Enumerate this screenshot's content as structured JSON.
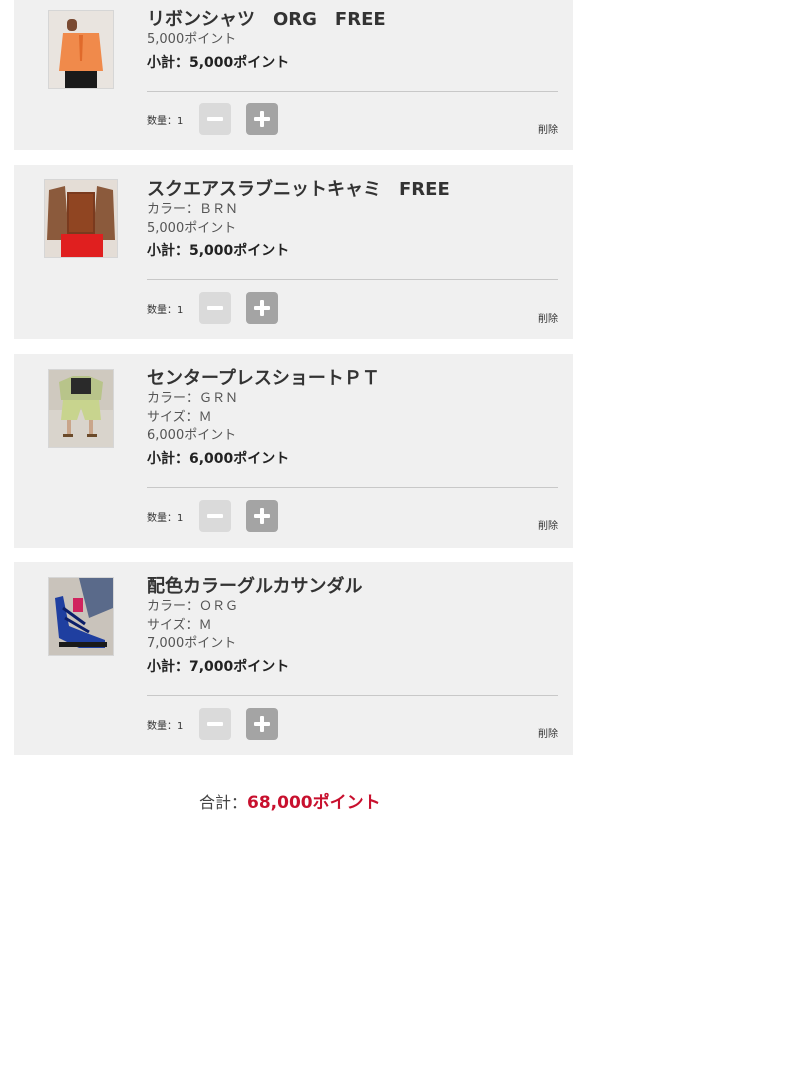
{
  "cart": {
    "qty_label": "数量：1",
    "delete_label": "削除",
    "items": [
      {
        "title": "リボンシャツ　ORG　FREE",
        "attrs": [],
        "price": "5,000ポイント",
        "subtotal": "小計：5,000ポイント"
      },
      {
        "title": "スクエアスラブニットキャミ　FREE",
        "attrs": [
          "カラー：ＢＲＮ"
        ],
        "price": "5,000ポイント",
        "subtotal": "小計：5,000ポイント"
      },
      {
        "title": "センタープレスショートＰＴ",
        "attrs": [
          "カラー：ＧＲＮ",
          "サイズ：Ｍ"
        ],
        "price": "6,000ポイント",
        "subtotal": "小計：6,000ポイント"
      },
      {
        "title": "配色カラーグルカサンダル",
        "attrs": [
          "カラー：ＯＲＧ",
          "サイズ：Ｍ"
        ],
        "price": "7,000ポイント",
        "subtotal": "小計：7,000ポイント"
      }
    ]
  },
  "total": {
    "label": "合計：",
    "value": "68,000ポイント"
  },
  "colors": {
    "panel": "#f0f0f0",
    "accent_red": "#c8102e",
    "minus_button": "#dadada",
    "plus_button": "#a4a4a4"
  }
}
